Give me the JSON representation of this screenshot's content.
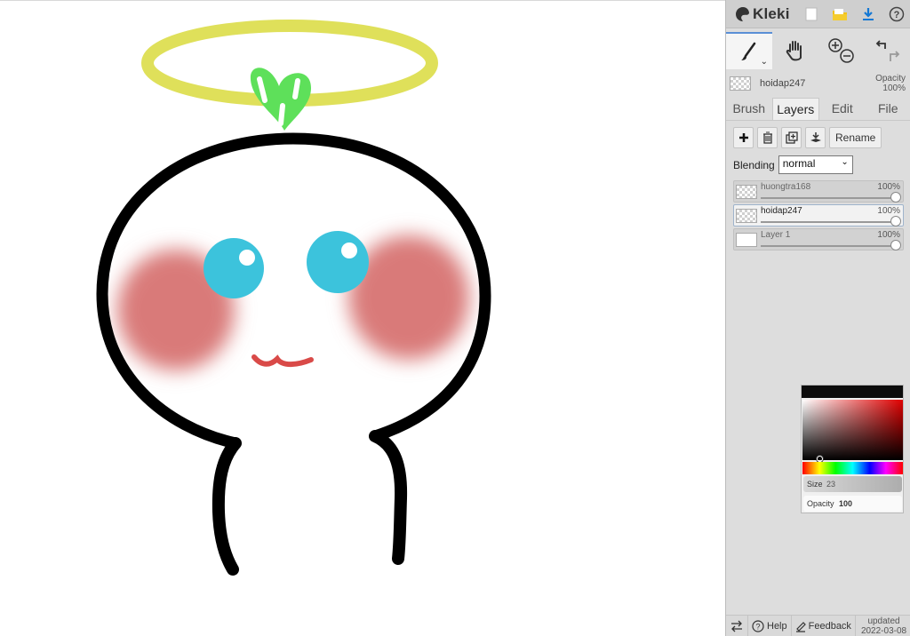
{
  "app": {
    "name": "Kleki"
  },
  "toolbar": {
    "icons": [
      "kleki-logo-icon",
      "new-image-icon",
      "open-folder-icon",
      "download-icon",
      "help-icon"
    ],
    "tools": [
      "brush-icon",
      "hand-icon",
      "zoom-in-icon",
      "zoom-out-icon",
      "undo-icon",
      "redo-icon"
    ]
  },
  "current_layer": {
    "name": "hoidap247",
    "opacity_label": "Opacity",
    "opacity_value": "100%"
  },
  "tabs": [
    {
      "label": "Brush",
      "active": false
    },
    {
      "label": "Layers",
      "active": true
    },
    {
      "label": "Edit",
      "active": false
    },
    {
      "label": "File",
      "active": false
    }
  ],
  "layer_actions": {
    "rename": "Rename"
  },
  "blending": {
    "label": "Blending",
    "value": "normal"
  },
  "layers": [
    {
      "name": "huongtra168",
      "opacity": "100%",
      "selected": false
    },
    {
      "name": "hoidap247",
      "opacity": "100%",
      "selected": true
    },
    {
      "name": "Layer 1",
      "opacity": "100%",
      "selected": false
    }
  ],
  "color_picker": {
    "current_color": "#0c0c0c",
    "size_label": "Size",
    "size_value": "23",
    "opacity_label": "Opacity",
    "opacity_value": "100"
  },
  "bottom": {
    "help": "Help",
    "feedback": "Feedback",
    "updated_label": "updated",
    "updated_date": "2022-03-08"
  },
  "colors": {
    "halo": "#dfe05a",
    "sprout": "#5ee05a",
    "eyes": "#3cc3dc",
    "blush": "#d97a79",
    "mouth": "#d94a48",
    "outline": "#000000"
  }
}
